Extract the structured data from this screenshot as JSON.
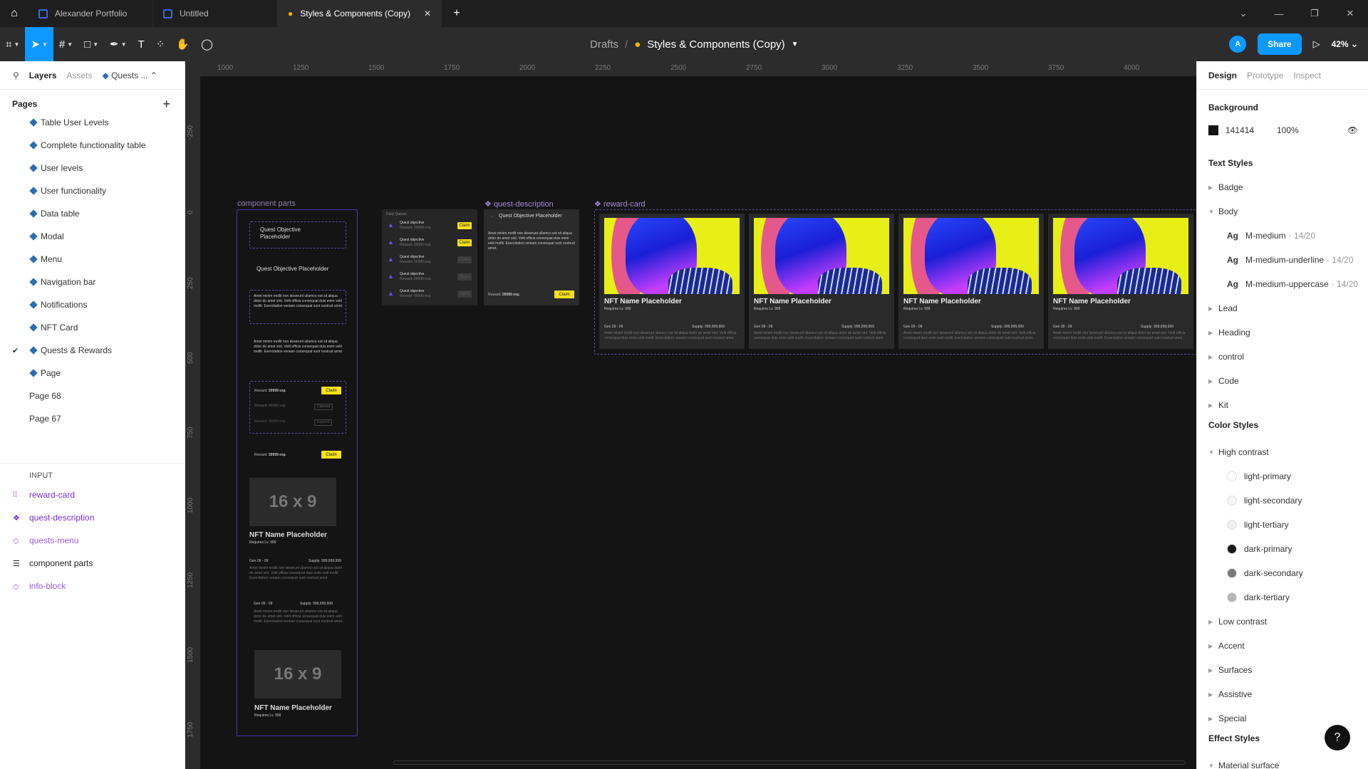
{
  "tabs": [
    {
      "label": "Alexander Portfolio"
    },
    {
      "label": "Untitled"
    },
    {
      "label": "Styles & Components (Copy)"
    }
  ],
  "header": {
    "drafts": "Drafts",
    "separator": "/",
    "file_title": "Styles & Components (Copy)",
    "avatar_letter": "A",
    "share_label": "Share",
    "zoom": "42%"
  },
  "left_panel": {
    "tabs": {
      "layers": "Layers",
      "assets": "Assets",
      "page_selector": "Quests ..."
    },
    "pages_title": "Pages",
    "pages": [
      {
        "label": "Table User Levels",
        "icon": "diamond"
      },
      {
        "label": "Complete functionality table",
        "icon": "diamond"
      },
      {
        "label": "User levels",
        "icon": "diamond"
      },
      {
        "label": "User functionality",
        "icon": "diamond"
      },
      {
        "label": "Data table",
        "icon": "diamond"
      },
      {
        "label": "Modal",
        "icon": "diamond"
      },
      {
        "label": "Menu",
        "icon": "diamond"
      },
      {
        "label": "Navigation bar",
        "icon": "diamond"
      },
      {
        "label": "Notifications",
        "icon": "diamond"
      },
      {
        "label": "NFT Card",
        "icon": "diamond"
      },
      {
        "label": "Quests & Rewards",
        "icon": "diamond",
        "checked": true
      },
      {
        "label": "Page",
        "icon": "diamond"
      },
      {
        "label": "Page 68",
        "icon": "none"
      },
      {
        "label": "Page 67",
        "icon": "none"
      }
    ],
    "layer_group": "INPUT",
    "layers": [
      {
        "label": "reward-card",
        "icon": "component-set-icon"
      },
      {
        "label": "quest-description",
        "icon": "component-icon"
      },
      {
        "label": "quests-menu",
        "icon": "instance-icon"
      },
      {
        "label": "component parts",
        "icon": "frame-icon"
      },
      {
        "label": "info-block",
        "icon": "instance-icon"
      }
    ]
  },
  "canvas": {
    "ruler_top": [
      "1000",
      "1250",
      "1500",
      "1750",
      "2000",
      "2250",
      "2500",
      "2750",
      "3000",
      "3250",
      "3500",
      "3750",
      "4000"
    ],
    "ruler_left": [
      "-250",
      "0",
      "250",
      "500",
      "750",
      "1000",
      "1250",
      "1500",
      "1750"
    ],
    "frames": {
      "component_parts": "component parts",
      "quest_description": "quest-description",
      "reward_card": "reward-card"
    },
    "parts": {
      "quest_objective": "Quest Objective Placeholder",
      "body_text": "Amet minim mollit non deserunt ullamco est sit aliqua dolor do amet sint. Velit officia consequat duis enim velit mollit. Exercitation veniam consequat sunt nostrud amet.",
      "reward_prefix": "Reward:",
      "reward_value": "99999 exp.",
      "claim": "Claim",
      "claimed": "Claimed",
      "expired": "Expired",
      "placeholder_16x9": "16 x 9",
      "nft_name": "NFT Name Placeholder",
      "requires": "Requires Lv. 999",
      "gen": "Gen 09 - 09",
      "supply": "Supply: 999,999,999",
      "daily_quests": "Daily Quests",
      "quest_objective_short": "Quest objective",
      "reward_small": "Reward: 99999 exp."
    }
  },
  "right_panel": {
    "tabs": {
      "design": "Design",
      "prototype": "Prototype",
      "inspect": "Inspect"
    },
    "background_title": "Background",
    "background_hex": "141414",
    "background_opacity": "100%",
    "text_styles_title": "Text Styles",
    "text_styles": {
      "badge": "Badge",
      "body": "Body",
      "lead": "Lead",
      "heading": "Heading",
      "control": "control",
      "code": "Code",
      "kit": "Kit",
      "body_children": [
        {
          "label": "M-medium",
          "meta": "· 14/20"
        },
        {
          "label": "M-medium-underline",
          "meta": "· 14/20"
        },
        {
          "label": "M-medium-uppercase",
          "meta": "· 14/20"
        }
      ]
    },
    "color_styles_title": "Color Styles",
    "color_styles": {
      "high_contrast": "High contrast",
      "children": [
        {
          "label": "light-primary",
          "color": "#ffffff"
        },
        {
          "label": "light-secondary",
          "color": "#f5f5f5"
        },
        {
          "label": "light-tertiary",
          "color": "#eeeeee"
        },
        {
          "label": "dark-primary",
          "color": "#1a1a1a"
        },
        {
          "label": "dark-secondary",
          "color": "#7a7a7a"
        },
        {
          "label": "dark-tertiary",
          "color": "#b5b5b5"
        }
      ],
      "low_contrast": "Low contrast",
      "accent": "Accent",
      "surfaces": "Surfaces",
      "assistive": "Assistive",
      "special": "Special"
    },
    "effect_styles_title": "Effect Styles",
    "effect_item": "Material surface"
  },
  "help": "?"
}
